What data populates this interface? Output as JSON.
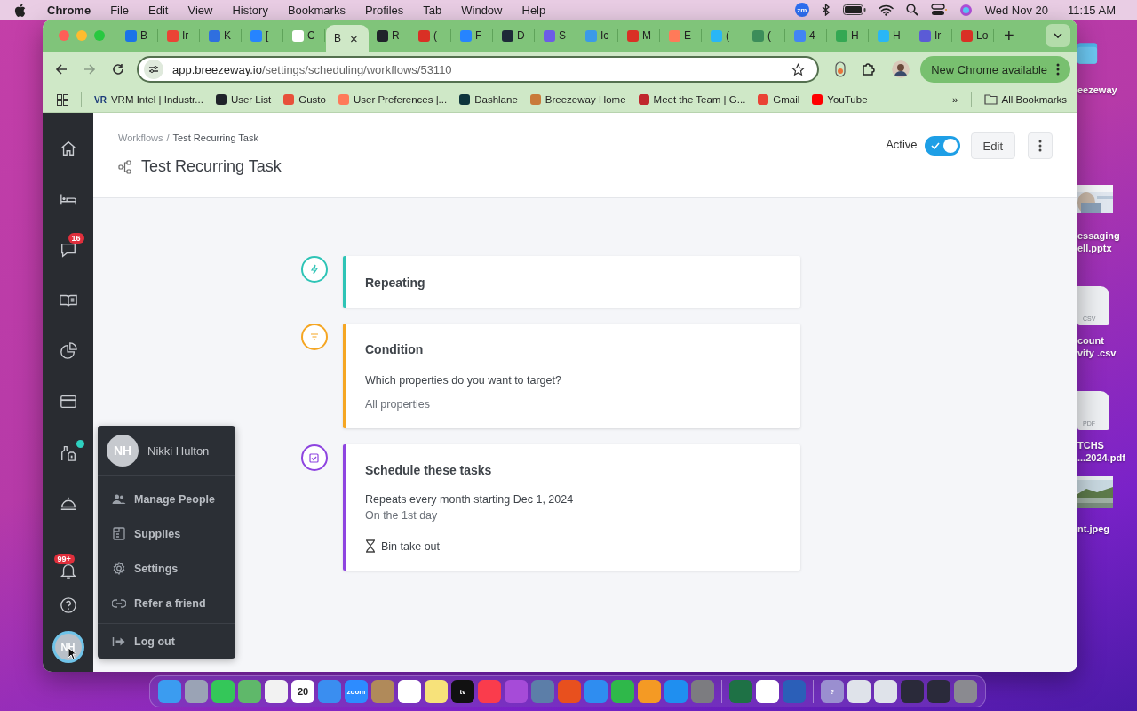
{
  "menubar": {
    "app": "Chrome",
    "menus": [
      "File",
      "Edit",
      "View",
      "History",
      "Bookmarks",
      "Profiles",
      "Tab",
      "Window",
      "Help"
    ],
    "zoom_badge": "zm",
    "date": "Wed Nov 20",
    "time": "11:15 AM"
  },
  "browser": {
    "tabs": [
      {
        "label": "B",
        "selected": false,
        "color": "#1a73e8"
      },
      {
        "label": "Ir",
        "selected": false,
        "color": "#ea4335"
      },
      {
        "label": "K",
        "selected": false,
        "color": "#2f6fdf"
      },
      {
        "label": "[",
        "selected": false,
        "color": "#2684ff"
      },
      {
        "label": "C",
        "selected": false,
        "color": "#ffffff"
      },
      {
        "label": "B",
        "selected": true,
        "close": "×"
      },
      {
        "label": "R",
        "selected": false,
        "color": "#20232a"
      },
      {
        "label": "(",
        "selected": false,
        "color": "#d93025"
      },
      {
        "label": "F",
        "selected": false,
        "color": "#2684ff"
      },
      {
        "label": "D",
        "selected": false,
        "color": "#1e2a38"
      },
      {
        "label": "S",
        "selected": false,
        "color": "#6c5ce7"
      },
      {
        "label": "Ic",
        "selected": false,
        "color": "#3b9ae8"
      },
      {
        "label": "M",
        "selected": false,
        "color": "#d93025"
      },
      {
        "label": "E",
        "selected": false,
        "color": "#ff7a59"
      },
      {
        "label": "(",
        "selected": false,
        "color": "#29b6f6"
      },
      {
        "label": "(",
        "selected": false,
        "color": "#3c8d5a"
      },
      {
        "label": "4",
        "selected": false,
        "color": "#4285f4"
      },
      {
        "label": "H",
        "selected": false,
        "color": "#34a853"
      },
      {
        "label": "H",
        "selected": false,
        "color": "#29b6f6"
      },
      {
        "label": "Ir",
        "selected": false,
        "color": "#5b5bd6"
      },
      {
        "label": "Lo",
        "selected": false,
        "color": "#d93025"
      }
    ],
    "new_tab": "+",
    "url_host": "app.breezeway.io",
    "url_path": "/settings/scheduling/workflows/53110",
    "update_button": "New Chrome available",
    "bookmarks": [
      {
        "badge": "VR",
        "label": "VRM Intel | Industr..."
      },
      {
        "label": "User List",
        "color": "#20232a"
      },
      {
        "label": "Gusto",
        "color": "#e8503a"
      },
      {
        "label": "User Preferences |...",
        "color": "#ff7a59"
      },
      {
        "label": "Dashlane",
        "color": "#0e353d"
      },
      {
        "label": "Breezeway Home",
        "color": "#c97a3a"
      },
      {
        "label": "Meet the Team | G...",
        "color": "#c0272d"
      },
      {
        "label": "Gmail",
        "color": "#ea4335"
      },
      {
        "label": "YouTube",
        "color": "#ff0000"
      }
    ],
    "more": "»",
    "all_bookmarks": "All Bookmarks"
  },
  "sidebar": {
    "chat_badge": "16",
    "alerts_badge": "99+",
    "avatar": "NH"
  },
  "header": {
    "breadcrumb_parent": "Workflows",
    "breadcrumb_separator": "/",
    "breadcrumb_current": "Test Recurring Task",
    "title": "Test Recurring Task",
    "active_label": "Active",
    "active": true,
    "edit": "Edit"
  },
  "steps": [
    {
      "kind": "trigger",
      "color": "#2ec4b6",
      "title": "Repeating"
    },
    {
      "kind": "condition",
      "color": "#f5a623",
      "title": "Condition",
      "question": "Which properties do you want to target?",
      "answer": "All properties"
    },
    {
      "kind": "action",
      "color": "#8e44e0",
      "title": "Schedule these tasks",
      "schedule": "Repeats every month starting Dec 1, 2024",
      "detail": "On the 1st day",
      "task": "Bin take out"
    }
  ],
  "user_menu": {
    "initials": "NH",
    "name": "Nikki Hulton",
    "items": [
      {
        "kind": "people",
        "label": "Manage People"
      },
      {
        "kind": "supplies",
        "label": "Supplies"
      },
      {
        "kind": "settings",
        "label": "Settings"
      },
      {
        "kind": "link",
        "label": "Refer a friend"
      }
    ],
    "logout": "Log out"
  },
  "desktop_files": [
    {
      "kind": "folder",
      "lines": [
        "eezeway"
      ]
    },
    {
      "kind": "slides",
      "lines": [
        "essaging",
        "ell.pptx"
      ]
    },
    {
      "kind": "document",
      "tag": "CSV",
      "lines": [
        "count",
        "vity .csv"
      ]
    },
    {
      "kind": "document",
      "tag": "PDF",
      "lines": [
        "TCHS",
        "...2024.pdf"
      ]
    },
    {
      "lines": [
        "nt.jpeg"
      ]
    }
  ],
  "dock": [
    {
      "color": "#3b9cf0"
    },
    {
      "color": "#9aa3b5"
    },
    {
      "color": "#34c759"
    },
    {
      "color": "#5fb86a"
    },
    {
      "color": "#f2f2f2"
    },
    {
      "color": "#ffffff",
      "text": "20"
    },
    {
      "color": "#3a8ef0"
    },
    {
      "color": "#2d8cff",
      "text": "zoom"
    },
    {
      "color": "#b08a5a"
    },
    {
      "color": "#ffffff"
    },
    {
      "color": "#f7e27a"
    },
    {
      "color": "#111111",
      "text": "tv"
    },
    {
      "color": "#fa3c4c"
    },
    {
      "color": "#a64bd8"
    },
    {
      "color": "#5c7ea8"
    },
    {
      "color": "#e8501e"
    },
    {
      "color": "#2f8df0"
    },
    {
      "color": "#2fb84a"
    },
    {
      "color": "#f49a24"
    },
    {
      "color": "#1f8ff0"
    },
    {
      "color": "#7c7c80"
    },
    {
      "color": "#1e7145"
    },
    {
      "color": "#ffffff"
    },
    {
      "color": "#2b5fb8"
    },
    {
      "color": "#9a8fd0",
      "text": "?"
    },
    {
      "color": "#dfe3ea"
    },
    {
      "color": "#dfe3ea"
    },
    {
      "color": "#2a2a3a"
    },
    {
      "color": "#2a2a3a"
    },
    {
      "color": "#8a8a90"
    }
  ]
}
